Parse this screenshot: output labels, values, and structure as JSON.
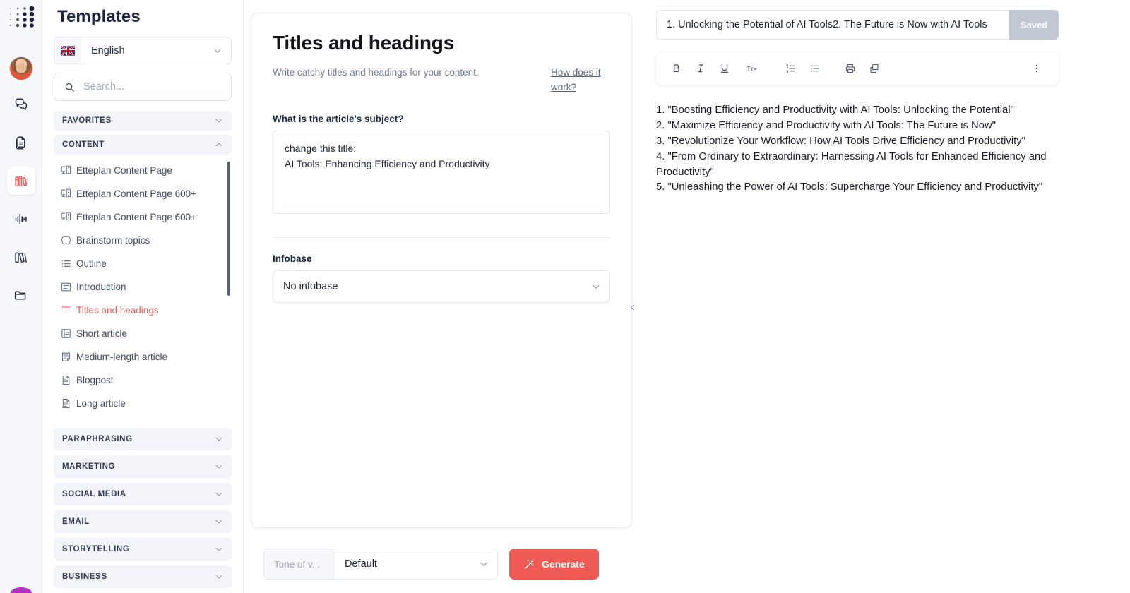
{
  "rail": {
    "logo_name": "dot-matrix-logo",
    "items": [
      {
        "name": "avatar",
        "label": "User avatar"
      },
      {
        "name": "chat-icon",
        "label": "Chat"
      },
      {
        "name": "documents-icon",
        "label": "Documents"
      },
      {
        "name": "templates-icon",
        "label": "Templates"
      },
      {
        "name": "audio-waveform-icon",
        "label": "Audio"
      },
      {
        "name": "library-icon",
        "label": "Library"
      },
      {
        "name": "folder-icon",
        "label": "Folders"
      }
    ],
    "active_index": 3,
    "active_color": "#ef5b54"
  },
  "sidebar": {
    "title": "Templates",
    "language": {
      "value": "English",
      "flag": "uk-flag-icon"
    },
    "search": {
      "value": "",
      "placeholder": "Search..."
    },
    "categories": [
      {
        "label": "FAVORITES",
        "expanded": false
      },
      {
        "label": "CONTENT",
        "expanded": true
      }
    ],
    "templates": [
      {
        "label": "Etteplan Content Page",
        "icon": "desktop-icon",
        "active": false
      },
      {
        "label": "Etteplan Content Page 600+",
        "icon": "desktop-icon",
        "active": false
      },
      {
        "label": "Etteplan Content Page 600+",
        "icon": "desktop-icon",
        "active": false
      },
      {
        "label": "Brainstorm topics",
        "icon": "brain-icon",
        "active": false
      },
      {
        "label": "Outline",
        "icon": "list-icon",
        "active": false
      },
      {
        "label": "Introduction",
        "icon": "paragraph-icon",
        "active": false
      },
      {
        "label": "Titles and headings",
        "icon": "text-t-icon",
        "active": true
      },
      {
        "label": "Short article",
        "icon": "short-doc-icon",
        "active": false
      },
      {
        "label": "Medium-length article",
        "icon": "medium-doc-icon",
        "active": false
      },
      {
        "label": "Blogpost",
        "icon": "document-icon",
        "active": false
      },
      {
        "label": "Long article",
        "icon": "document-icon",
        "active": false
      }
    ],
    "categories_rest": [
      {
        "label": "PARAPHRASING"
      },
      {
        "label": "MARKETING"
      },
      {
        "label": "SOCIAL MEDIA"
      },
      {
        "label": "EMAIL"
      },
      {
        "label": "STORYTELLING"
      },
      {
        "label": "BUSINESS"
      }
    ]
  },
  "main": {
    "heading": "Titles and headings",
    "description": "Write catchy titles and headings for your content.",
    "help_link": "How does it work?",
    "subject_label": "What is the article's subject?",
    "subject_value": "change this title:\nAI Tools: Enhancing Efficiency and Productivity",
    "infobase_label": "Infobase",
    "infobase_value": "No infobase",
    "tone_prefix": "Tone of v...",
    "tone_value": "Default",
    "generate_label": "Generate",
    "generate_color": "#ef5b54",
    "collapse_icon": "chevron-left-icon"
  },
  "editor": {
    "title_value": "1. Unlocking the Potential of AI Tools2. The Future is Now with AI Tools",
    "save_label": "Saved",
    "toolbar": [
      {
        "name": "bold-button",
        "glyph": "B"
      },
      {
        "name": "italic-button",
        "glyph": "I"
      },
      {
        "name": "underline-button",
        "glyph": "U"
      },
      {
        "name": "font-size-button",
        "glyph": "Tt"
      },
      {
        "name": "numbered-list-button",
        "glyph": "list-ol"
      },
      {
        "name": "bulleted-list-button",
        "glyph": "list-ul"
      },
      {
        "name": "print-button",
        "glyph": "printer"
      },
      {
        "name": "copy-button",
        "glyph": "copy"
      },
      {
        "name": "more-options-button",
        "glyph": "dots-vertical"
      }
    ],
    "content_lines": [
      "1. \"Boosting Efficiency and Productivity with AI Tools: Unlocking the Potential\"",
      "2. \"Maximize Efficiency and Productivity with AI Tools: The Future is Now\"",
      "3. \"Revolutionize Your Workflow: How AI Tools Drive Efficiency and Productivity\"",
      "4. \"From Ordinary to Extraordinary: Harnessing AI Tools for Enhanced Efficiency and Productivity\"",
      "5. \"Unleashing the Power of AI Tools: Supercharge Your Efficiency and Productivity\""
    ]
  }
}
